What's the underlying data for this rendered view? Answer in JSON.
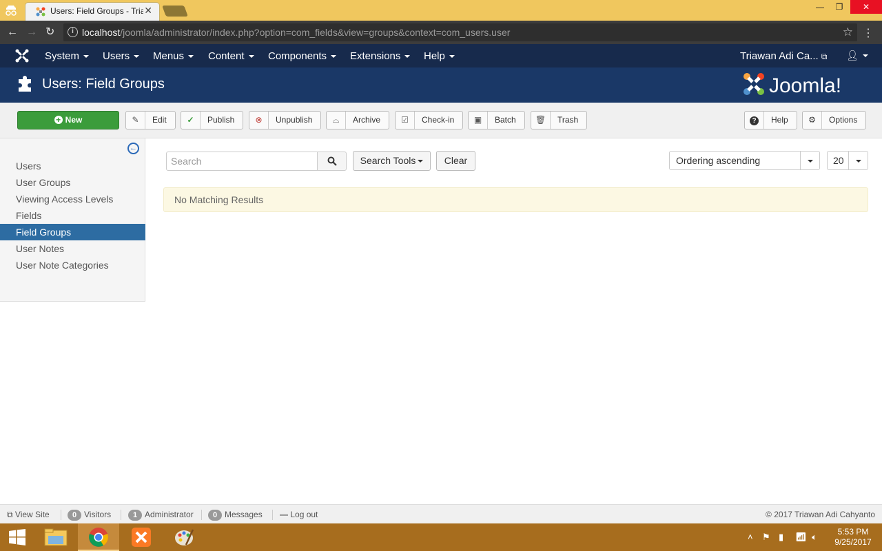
{
  "browser": {
    "tab_title": "Users: Field Groups - Triawan Adi Cahyanto",
    "url_host": "localhost",
    "url_path": "/joomla/administrator/index.php?option=com_fields&view=groups&context=com_users.user"
  },
  "navbar": {
    "items": [
      "System",
      "Users",
      "Menus",
      "Content",
      "Components",
      "Extensions",
      "Help"
    ],
    "user_label": "Triawan Adi Ca..."
  },
  "header": {
    "title": "Users: Field Groups",
    "brand": "Joomla!"
  },
  "toolbar": {
    "new": "New",
    "edit": "Edit",
    "publish": "Publish",
    "unpublish": "Unpublish",
    "archive": "Archive",
    "checkin": "Check-in",
    "batch": "Batch",
    "trash": "Trash",
    "help": "Help",
    "options": "Options"
  },
  "sidebar": {
    "items": [
      {
        "label": "Users",
        "active": false
      },
      {
        "label": "User Groups",
        "active": false
      },
      {
        "label": "Viewing Access Levels",
        "active": false
      },
      {
        "label": "Fields",
        "active": false
      },
      {
        "label": "Field Groups",
        "active": true
      },
      {
        "label": "User Notes",
        "active": false
      },
      {
        "label": "User Note Categories",
        "active": false
      }
    ]
  },
  "filters": {
    "search_placeholder": "Search",
    "search_tools": "Search Tools",
    "clear": "Clear",
    "ordering": "Ordering ascending",
    "limit": "20"
  },
  "message": "No Matching Results",
  "status": {
    "view_site": "View Site",
    "visitors_count": "0",
    "visitors": "Visitors",
    "admin_count": "1",
    "admin": "Administrator",
    "messages_count": "0",
    "messages": "Messages",
    "logout": "Log out",
    "copyright": "© 2017 Triawan Adi Cahyanto"
  },
  "taskbar": {
    "time": "5:53 PM",
    "date": "9/25/2017"
  },
  "colors": {
    "navbar": "#172a4c",
    "header": "#1a3867",
    "new_button": "#3b9c3b",
    "sidebar_active": "#2d6ca2"
  }
}
